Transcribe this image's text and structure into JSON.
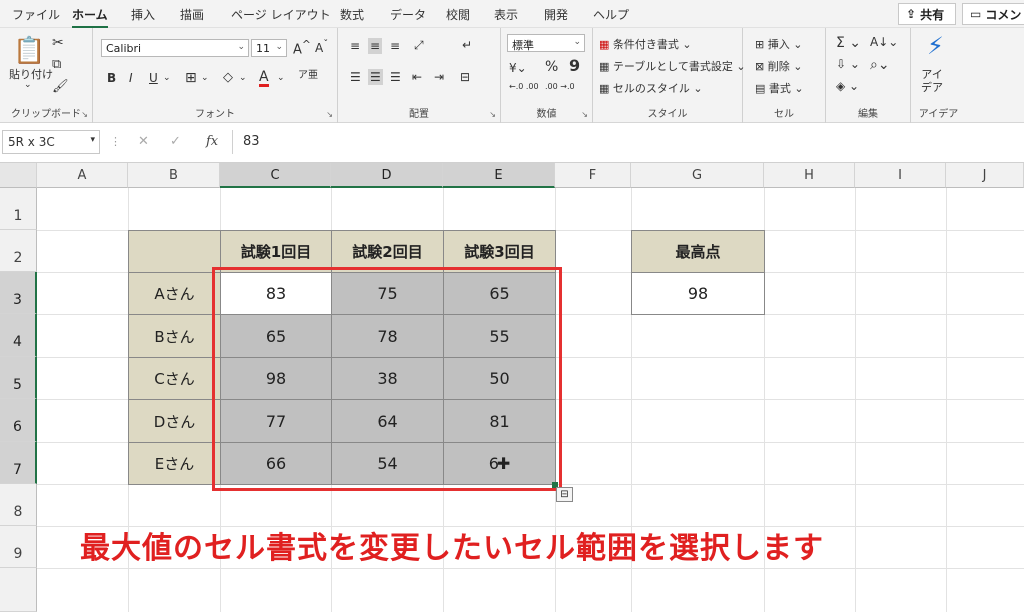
{
  "menu": {
    "tabs": [
      "ファイル",
      "ホーム",
      "挿入",
      "描画",
      "ページ レイアウト",
      "数式",
      "データ",
      "校閲",
      "表示",
      "開発",
      "ヘルプ"
    ],
    "active": "ホーム",
    "share_label": "共有",
    "comment_label": "コメント"
  },
  "ribbon": {
    "clipboard": {
      "label": "クリップボード",
      "paste": "貼り付け"
    },
    "font": {
      "label": "フォント",
      "name": "Calibri",
      "size": "11",
      "bold": "B",
      "italic": "I",
      "underline": "U",
      "grow": "A^",
      "shrink": "Aˇ",
      "color_letter": "A"
    },
    "alignment": {
      "label": "配置"
    },
    "number": {
      "label": "数値",
      "format": "標準",
      "percent": "%",
      "comma": "9",
      "inc": "←.0 .00",
      "dec": ".00 →.0"
    },
    "styles": {
      "label": "スタイル",
      "conditional": "条件付き書式",
      "table": "テーブルとして書式設定",
      "cell_styles": "セルのスタイル"
    },
    "cells": {
      "label": "セル",
      "insert": "挿入",
      "delete": "削除",
      "format": "書式"
    },
    "editing": {
      "label": "編集"
    },
    "ideas": {
      "label": "アイデア",
      "button": "アイ\nデア"
    }
  },
  "formula_bar": {
    "name_box": "5R x 3C",
    "fx": "fx",
    "value": "83"
  },
  "columns": [
    "A",
    "B",
    "C",
    "D",
    "E",
    "F",
    "G",
    "H",
    "I",
    "J"
  ],
  "rows": [
    "1",
    "2",
    "3",
    "4",
    "5",
    "6",
    "7",
    "8",
    "9"
  ],
  "table": {
    "headers": [
      "試験1回目",
      "試験2回目",
      "試験3回目"
    ],
    "rows": [
      {
        "name": "Aさん",
        "values": [
          "83",
          "75",
          "65"
        ]
      },
      {
        "name": "Bさん",
        "values": [
          "65",
          "78",
          "55"
        ]
      },
      {
        "name": "Cさん",
        "values": [
          "98",
          "38",
          "50"
        ]
      },
      {
        "name": "Dさん",
        "values": [
          "77",
          "64",
          "81"
        ]
      },
      {
        "name": "Eさん",
        "values": [
          "66",
          "54",
          "6"
        ]
      }
    ]
  },
  "max_box": {
    "header": "最高点",
    "value": "98"
  },
  "caption": "最大値のセル書式を変更したいセル範囲を選択します"
}
